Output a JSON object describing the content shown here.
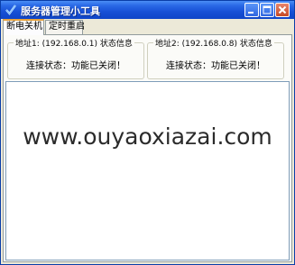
{
  "window": {
    "title": "服务器管理小工具"
  },
  "tabs": [
    {
      "label": "断电关机",
      "active": true
    },
    {
      "label": "定时重启",
      "active": false
    }
  ],
  "groups": [
    {
      "title": "地址1: (192.168.0.1) 状态信息",
      "status": "连接状态：功能已关闭！"
    },
    {
      "title": "地址2: (192.168.0.8) 状态信息",
      "status": "连接状态：功能已关闭！"
    }
  ],
  "watermark": "www.ouyaoxiazai.com",
  "colors": {
    "titlebar": "#1750d6",
    "close": "#c54a25",
    "tab_highlight": "#e8a23a"
  }
}
